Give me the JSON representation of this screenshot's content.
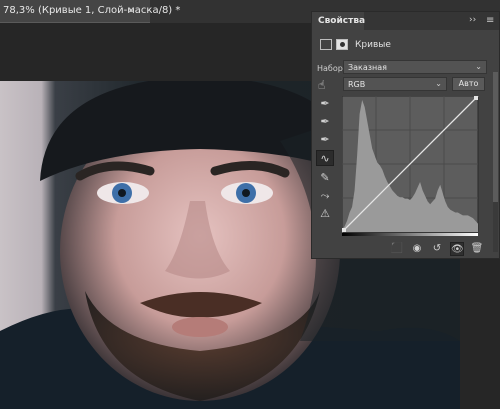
{
  "document_tab": {
    "label": "78,3% (Кривые 1, Слой-маска/8) *",
    "close_glyph": "×"
  },
  "properties_panel": {
    "title": "Свойства",
    "collapse_glyph": "››",
    "menu_glyph": "≡",
    "adjustment_name": "Кривые",
    "preset_label": "Набор:",
    "preset_value": "Заказная",
    "channel_value": "RGB",
    "auto_label": "Авто",
    "tools": [
      "target-adjust-icon",
      "black-eyedropper-icon",
      "gray-eyedropper-icon",
      "white-eyedropper-icon",
      "curve-points-icon",
      "pencil-icon",
      "smooth-icon",
      "clipping-warning-icon"
    ],
    "bottom_icons": [
      "clip-to-layer-icon",
      "view-previous-icon",
      "reset-icon",
      "visibility-icon",
      "trash-icon"
    ]
  },
  "chart_data": {
    "type": "area",
    "description_kind": "curves histogram",
    "x_range": [
      0,
      255
    ],
    "y_range": [
      0,
      255
    ],
    "histogram": [
      2,
      4,
      8,
      14,
      18,
      30,
      55,
      85,
      95,
      90,
      80,
      70,
      60,
      55,
      50,
      48,
      45,
      40,
      36,
      33,
      30,
      28,
      26,
      25,
      25,
      24,
      24,
      23,
      25,
      28,
      32,
      36,
      30,
      26,
      22,
      20,
      22,
      24,
      30,
      34,
      28,
      22,
      18,
      16,
      15,
      14,
      14,
      13,
      12,
      12,
      12,
      11,
      10,
      8,
      6
    ],
    "curve_points": [
      [
        0,
        0
      ],
      [
        255,
        255
      ]
    ],
    "accent_colors": {
      "curve": "#e6e6e6",
      "histogram": "#9a9a9a",
      "background": "#5d5d5d"
    }
  }
}
